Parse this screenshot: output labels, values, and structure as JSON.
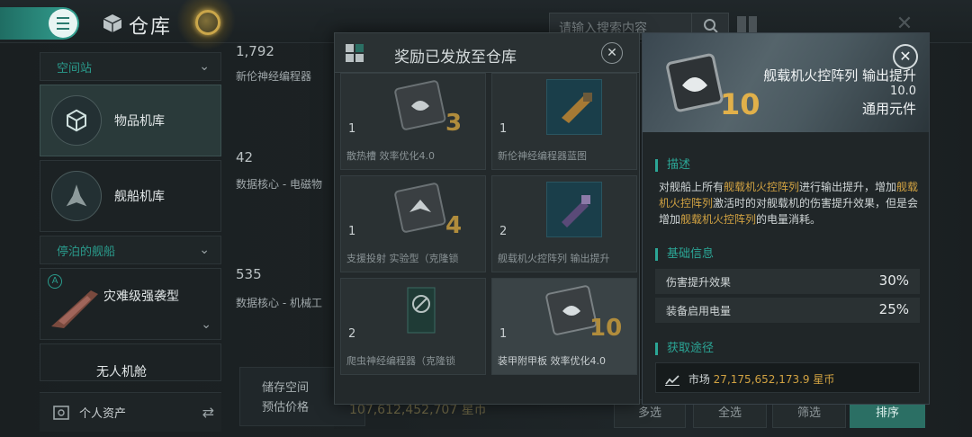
{
  "header": {
    "title": "仓库",
    "search_placeholder": "请输入搜索内容"
  },
  "sidebar": {
    "section_station": "空间站",
    "items": [
      {
        "label": "物品机库"
      },
      {
        "label": "舰船机库"
      }
    ],
    "section_docked": "停泊的舰船",
    "ship": {
      "badge": "A",
      "label": "灾难级强袭型"
    },
    "drone_bay": "无人机舱",
    "personal_assets": "个人资产"
  },
  "warehouse": {
    "items": [
      {
        "count": "1,792",
        "name": "新伦神经编程器"
      },
      {
        "count": "42",
        "name": "数据核心 - 电磁物"
      },
      {
        "count": "535",
        "name": "数据核心 - 机械工"
      }
    ],
    "storage_label": "储存空间",
    "estimate_label": "预估价格",
    "total_value": "107,612,452,707 星币"
  },
  "bottom_buttons": [
    "多选",
    "全选",
    "筛选",
    "排序"
  ],
  "modal": {
    "title": "奖励已发放至仓库",
    "rewards": [
      {
        "count": "1",
        "name": "散热槽 效率优化4.0",
        "level": "3"
      },
      {
        "count": "1",
        "name": "新伦神经编程器蓝图",
        "level": ""
      },
      {
        "count": "1",
        "name": "支援投射 实验型（克隆锁",
        "level": "4"
      },
      {
        "count": "2",
        "name": "舰载机火控阵列 输出提升",
        "level": ""
      },
      {
        "count": "2",
        "name": "爬虫神经编程器（克隆锁",
        "level": ""
      },
      {
        "count": "1",
        "name": "装甲附甲板 效率优化4.0",
        "level": "10"
      }
    ]
  },
  "detail": {
    "name": "舰载机火控阵列 输出提升",
    "value": "10.0",
    "type": "通用元件",
    "level": "10",
    "desc_title": "描述",
    "desc_parts": {
      "a": "对舰船上所有",
      "b": "舰载机火控阵列",
      "c": "进行输出提升，增加",
      "d": "舰载机火控阵列",
      "e": "激活时的对舰载机的伤害提升效果，但是会增加",
      "f": "舰载机火控阵列",
      "g": "的电量消耗。"
    },
    "basic_title": "基础信息",
    "stats": [
      {
        "label": "伤害提升效果",
        "value": "30%"
      },
      {
        "label": "装备启用电量",
        "value": "25%"
      }
    ],
    "source_title": "获取途径",
    "source_label": "市场",
    "source_value": "27,175,652,173.9 星币"
  },
  "colors": {
    "accent": "#2ba696",
    "highlight": "#d1a242",
    "level_gold": "#e1b04a"
  }
}
